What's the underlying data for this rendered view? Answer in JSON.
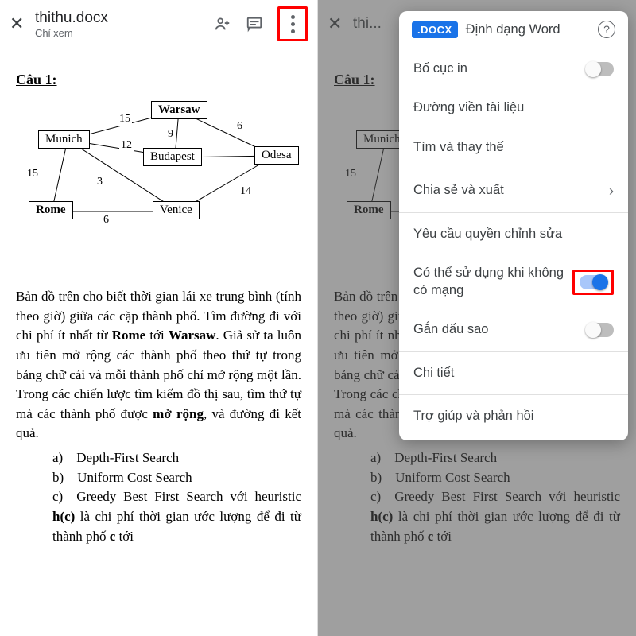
{
  "file": {
    "name": "thithu.docx",
    "mode": "Chỉ xem"
  },
  "right_file_name_truncated": "thi...",
  "doc": {
    "question": "Câu 1:",
    "cities": {
      "warsaw": "Warsaw",
      "munich": "Munich",
      "budapest": "Budapest",
      "odesa": "Odesa",
      "rome": "Rome",
      "venice": "Venice"
    },
    "edge_labels": {
      "munich_warsaw": "15",
      "warsaw_budapest": "9",
      "munich_budapest": "12",
      "warsaw_odesa": "6",
      "munich_rome": "15",
      "munich_venice": "3",
      "venice_odesa": "14",
      "rome_venice": "6"
    },
    "para_html": "Bản đồ trên cho biết thời gian lái xe trung bình (tính theo giờ) giữa các cặp thành phố. Tìm đường đi với chi phí ít nhất từ <b>Rome</b> tới <b>Warsaw</b>. Giả sử ta luôn ưu tiên mở rộng các thành phố theo thứ tự trong bảng chữ cái và mỗi thành phố chỉ mở rộng một lần. Trong các chiến lược tìm kiếm đồ thị sau, tìm thứ tự mà các thành phố được <b>mở rộng</b>, và đường đi kết quả.",
    "options": {
      "a": "a) Depth-First Search",
      "b": "b) Uniform Cost Search",
      "c_html": "c) Greedy Best First Search với heuristic <b>h(c)</b> là chi phí thời gian ước lượng để đi từ thành phố <b>c</b> tới"
    }
  },
  "menu": {
    "badge": ".DOCX",
    "format_label": "Định dạng Word",
    "items": {
      "print_layout": "Bố cục in",
      "borders": "Đường viền tài liệu",
      "find_replace": "Tìm và thay thế",
      "share_export": "Chia sẻ và xuất",
      "request_edit": "Yêu cầu quyền chỉnh sửa",
      "offline": "Có thể sử dụng khi không có mạng",
      "star": "Gắn dấu sao",
      "details": "Chi tiết",
      "help": "Trợ giúp và phản hồi"
    }
  }
}
